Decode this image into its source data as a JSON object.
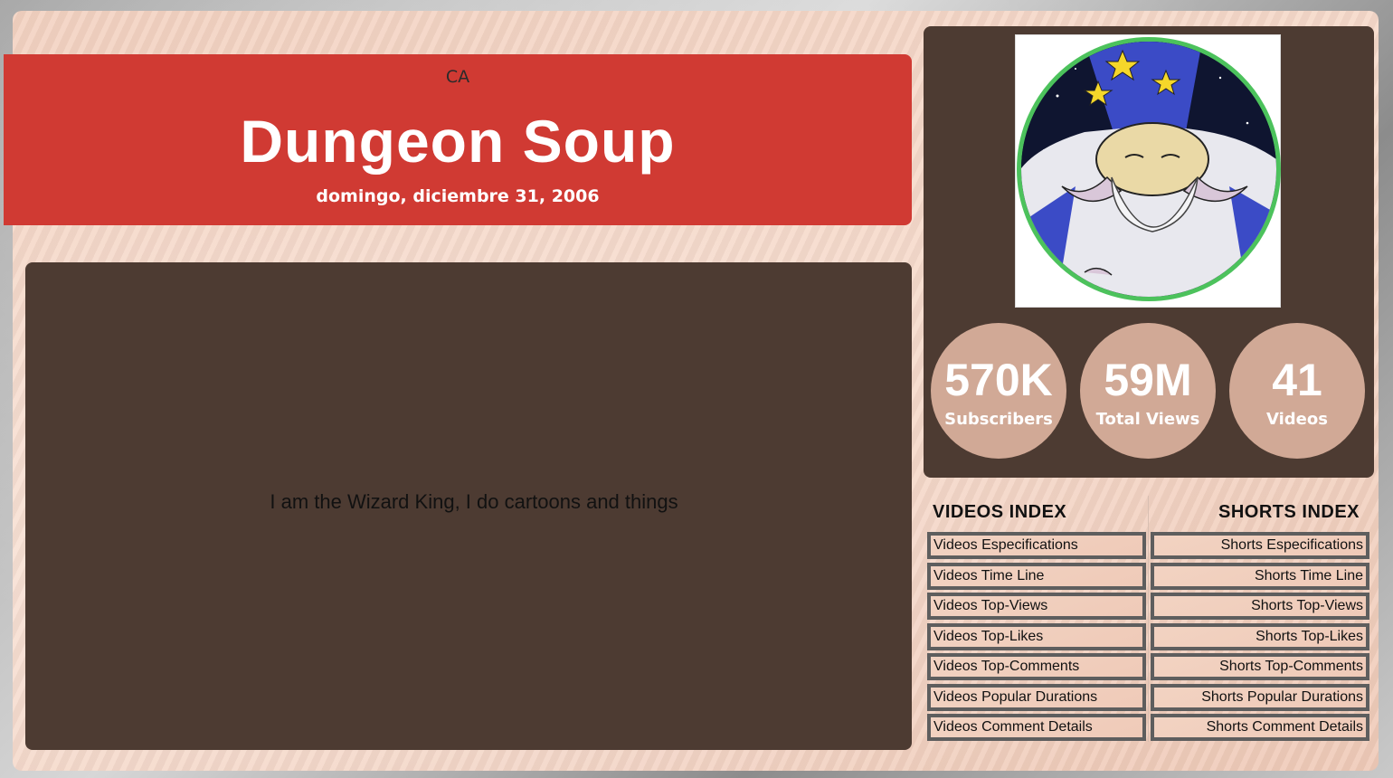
{
  "channel": {
    "country": "CA",
    "name": "Dungeon Soup",
    "created": "domingo, diciembre 31, 2006",
    "description": "I am the Wizard King, I do cartoons and things"
  },
  "stats": [
    {
      "value": "570K",
      "label": "Subscribers"
    },
    {
      "value": "59M",
      "label": "Total Views"
    },
    {
      "value": "41",
      "label": "Videos"
    }
  ],
  "videos_index": {
    "title": "VIDEOS INDEX",
    "links": [
      "Videos Especifications",
      "Videos Time Line",
      "Videos Top-Views",
      "Videos Top-Likes",
      "Videos Top-Comments",
      "Videos Popular Durations",
      "Videos Comment Details"
    ]
  },
  "shorts_index": {
    "title": "SHORTS INDEX",
    "links": [
      "Shorts Especifications",
      "Shorts Time Line",
      "Shorts Top-Views",
      "Shorts Top-Likes",
      "Shorts Top-Comments",
      "Shorts Popular Durations",
      "Shorts Comment Details"
    ]
  },
  "colors": {
    "banner": "#d03a33",
    "panel": "#4d3b32",
    "stat_circle": "#d1a996",
    "avatar_ring": "#4cc25c"
  }
}
